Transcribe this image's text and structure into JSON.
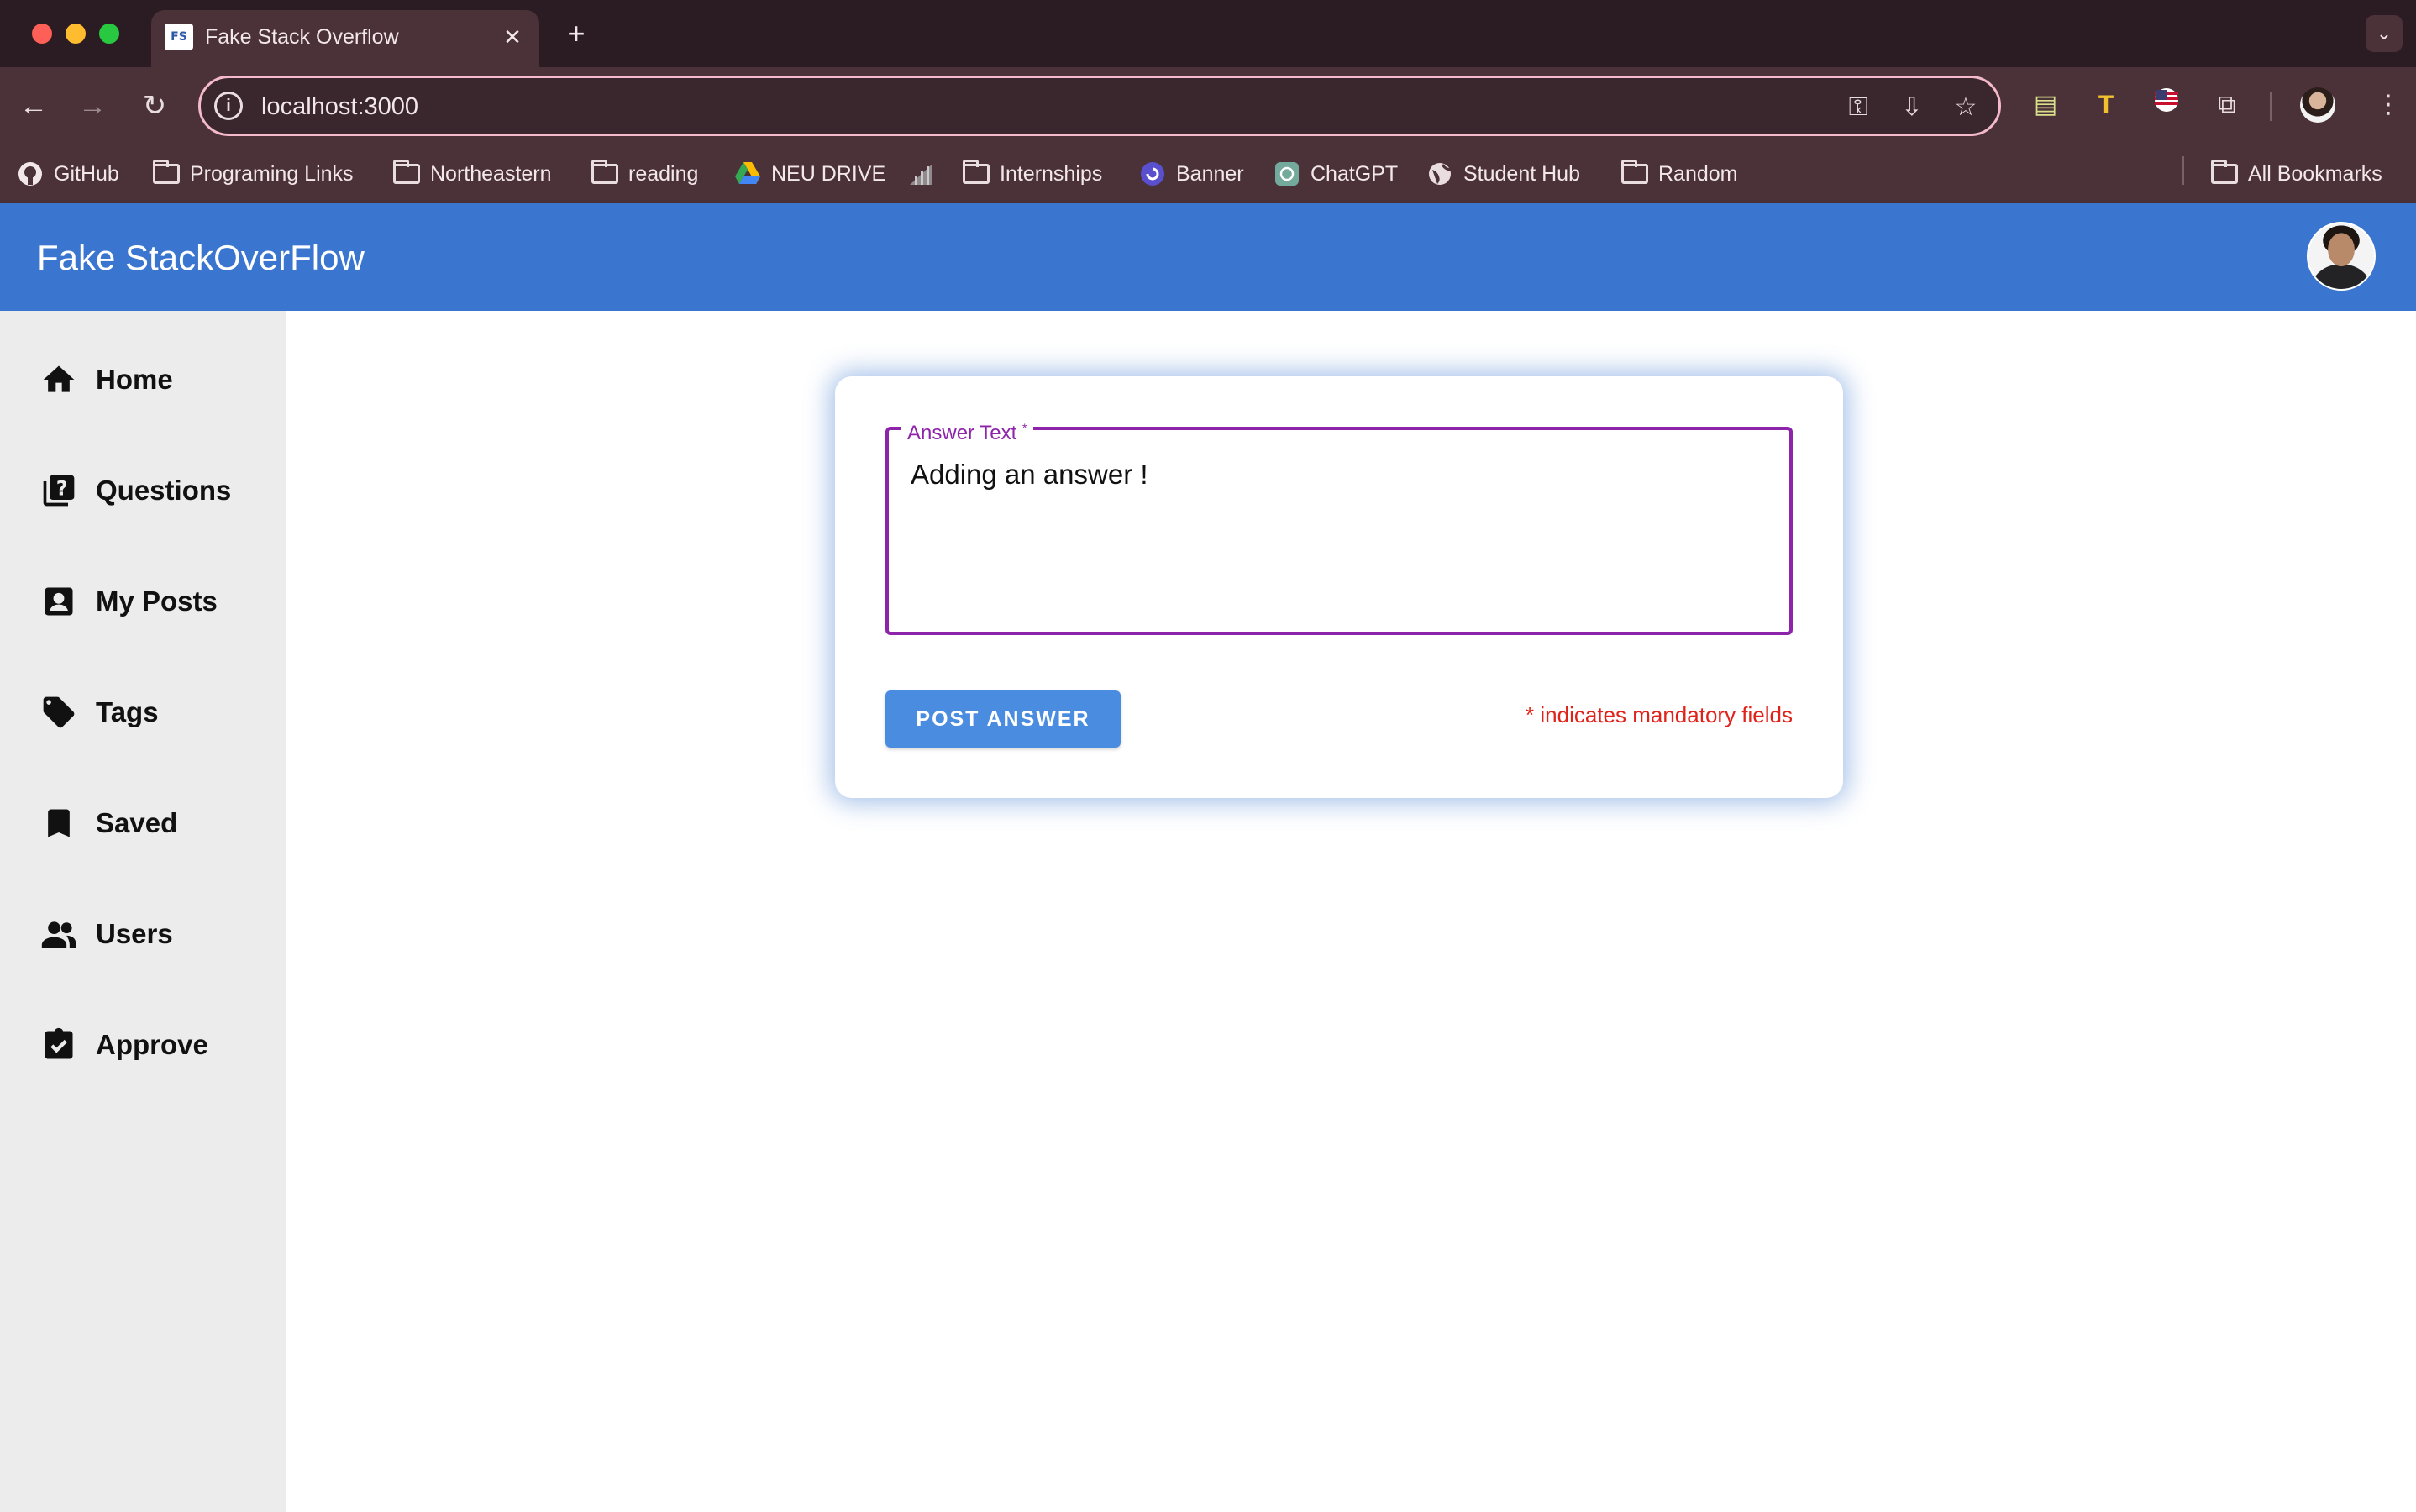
{
  "browser": {
    "tab_title": "Fake Stack Overflow",
    "tab_favicon_text": "FS",
    "url": "localhost:3000",
    "bookmarks": [
      {
        "label": "GitHub",
        "icon": "github-icon"
      },
      {
        "label": "Programing Links",
        "icon": "folder-icon"
      },
      {
        "label": "Northeastern",
        "icon": "folder-icon"
      },
      {
        "label": "reading",
        "icon": "folder-icon"
      },
      {
        "label": "NEU DRIVE",
        "icon": "google-drive-icon"
      },
      {
        "label": "",
        "icon": "chart-icon"
      },
      {
        "label": "Internships",
        "icon": "folder-icon"
      },
      {
        "label": "Banner",
        "icon": "banner-icon"
      },
      {
        "label": "ChatGPT",
        "icon": "chatgpt-icon"
      },
      {
        "label": "Student Hub",
        "icon": "globe-icon"
      },
      {
        "label": "Random",
        "icon": "folder-icon"
      }
    ],
    "all_bookmarks": "All Bookmarks"
  },
  "app": {
    "title": "Fake StackOverFlow",
    "nav": [
      {
        "label": "Home",
        "icon": "home-icon"
      },
      {
        "label": "Questions",
        "icon": "questions-icon"
      },
      {
        "label": "My Posts",
        "icon": "account-box-icon"
      },
      {
        "label": "Tags",
        "icon": "tag-icon"
      },
      {
        "label": "Saved",
        "icon": "bookmark-icon"
      },
      {
        "label": "Users",
        "icon": "users-icon"
      },
      {
        "label": "Approve",
        "icon": "clipboard-check-icon"
      }
    ]
  },
  "form": {
    "field_label": "Answer Text",
    "required_marker": "*",
    "field_value": "Adding an answer !",
    "submit_label": "POST ANSWER",
    "mandatory_note": "* indicates mandatory fields"
  },
  "colors": {
    "appbar": "#3a75cf",
    "field_focus": "#8e24aa",
    "button": "#4a8ce0",
    "mandatory": "#e0231a",
    "sidebar": "#ececec"
  }
}
